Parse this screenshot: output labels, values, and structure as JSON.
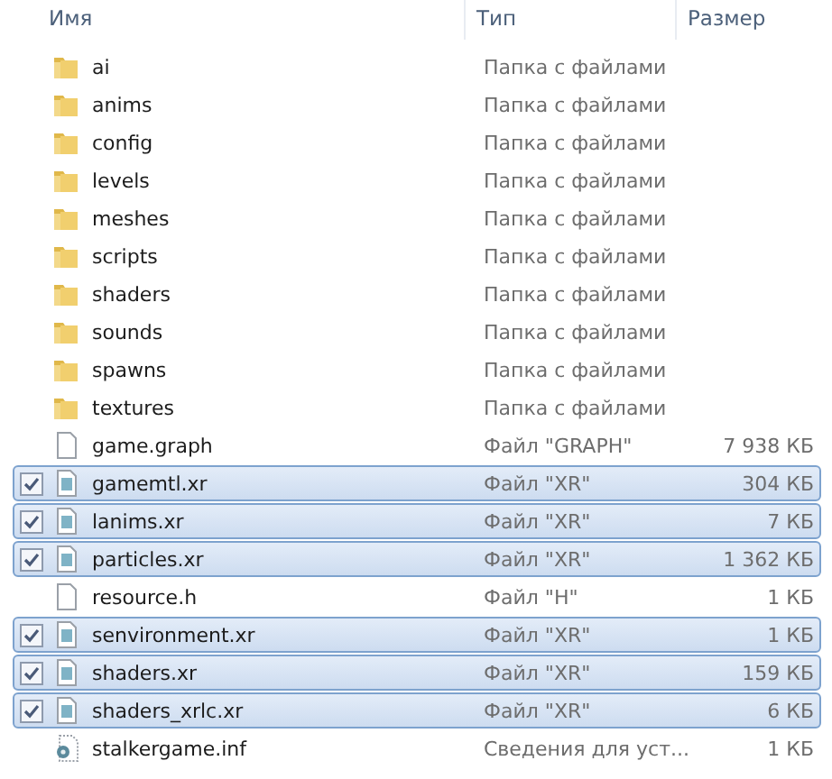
{
  "columns": [
    "Имя",
    "Тип",
    "Размер"
  ],
  "rows": [
    {
      "kind": "folder",
      "name": "ai",
      "type": "Папка с файлами",
      "selected": false
    },
    {
      "kind": "folder",
      "name": "anims",
      "type": "Папка с файлами",
      "selected": false
    },
    {
      "kind": "folder",
      "name": "config",
      "type": "Папка с файлами",
      "selected": false
    },
    {
      "kind": "folder",
      "name": "levels",
      "type": "Папка с файлами",
      "selected": false
    },
    {
      "kind": "folder",
      "name": "meshes",
      "type": "Папка с файлами",
      "selected": false
    },
    {
      "kind": "folder",
      "name": "scripts",
      "type": "Папка с файлами",
      "selected": false
    },
    {
      "kind": "folder",
      "name": "shaders",
      "type": "Папка с файлами",
      "selected": false
    },
    {
      "kind": "folder",
      "name": "sounds",
      "type": "Папка с файлами",
      "selected": false
    },
    {
      "kind": "folder",
      "name": "spawns",
      "type": "Папка с файлами",
      "selected": false
    },
    {
      "kind": "folder",
      "name": "textures",
      "type": "Папка с файлами",
      "selected": false
    },
    {
      "kind": "file",
      "name": "game.graph",
      "type": "Файл \"GRAPH\"",
      "size": "7 938 КБ",
      "selected": false
    },
    {
      "kind": "data",
      "name": "gamemtl.xr",
      "type": "Файл \"XR\"",
      "size": "304 КБ",
      "selected": true
    },
    {
      "kind": "data",
      "name": "lanims.xr",
      "type": "Файл \"XR\"",
      "size": "7 КБ",
      "selected": true
    },
    {
      "kind": "data",
      "name": "particles.xr",
      "type": "Файл \"XR\"",
      "size": "1 362 КБ",
      "selected": true
    },
    {
      "kind": "file",
      "name": "resource.h",
      "type": "Файл \"H\"",
      "size": "1 КБ",
      "selected": false
    },
    {
      "kind": "data",
      "name": "senvironment.xr",
      "type": "Файл \"XR\"",
      "size": "1 КБ",
      "selected": true
    },
    {
      "kind": "data",
      "name": "shaders.xr",
      "type": "Файл \"XR\"",
      "size": "159 КБ",
      "selected": true
    },
    {
      "kind": "data",
      "name": "shaders_xrlc.xr",
      "type": "Файл \"XR\"",
      "size": "6 КБ",
      "selected": true
    },
    {
      "kind": "settings",
      "name": "stalkergame.inf",
      "type": "Сведения для уст...",
      "size": "1 КБ",
      "selected": false
    }
  ]
}
